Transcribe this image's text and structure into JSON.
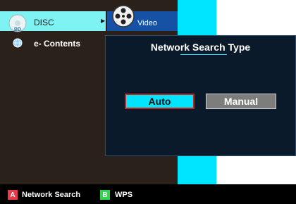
{
  "menu": {
    "disc": {
      "badge": "BD",
      "label": "DISC",
      "arrow": "▶"
    },
    "video": {
      "label": "Video"
    },
    "econtents": {
      "label": "e- Contents"
    }
  },
  "dialog": {
    "title": "Network Search Type",
    "buttons": {
      "auto": "Auto",
      "manual": "Manual"
    },
    "selected": "Auto"
  },
  "footer": {
    "keys": [
      {
        "key": "A",
        "label": "Network Search",
        "color": "#e83a4a"
      },
      {
        "key": "B",
        "label": "WPS",
        "color": "#32d64d"
      }
    ]
  },
  "colors": {
    "menu_bg": "#2a211b",
    "highlight": "#7df3f3",
    "accent_cyan": "#00e5ff",
    "video_blue": "#1552a6",
    "dialog_bg": "#0b1a2a",
    "focus_border": "#c0241c"
  },
  "icons": {
    "disc": "bluray-disc-icon",
    "video": "film-reel-icon",
    "econtents": "globe-icon"
  }
}
